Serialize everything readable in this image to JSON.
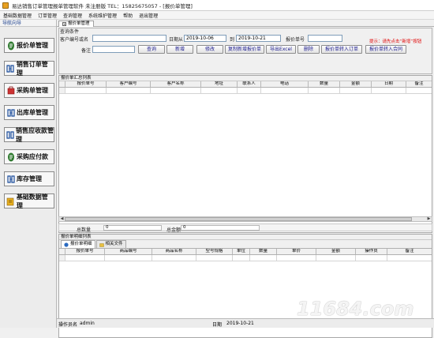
{
  "window": {
    "title": "易达销售订单管理报单管理软件 未注册版  TEL：15825675057    - [报价单管理]"
  },
  "menu": [
    "基础数据管理",
    "订单管理",
    "查询管理",
    "系统维护管理",
    "帮助",
    "退出管理"
  ],
  "nav": {
    "header": "导航向导",
    "items": [
      {
        "label": "报价单管理",
        "icon": "quote-icon"
      },
      {
        "label": "销售订单管理",
        "icon": "sales-order-icon"
      },
      {
        "label": "采购单管理",
        "icon": "purchase-icon"
      },
      {
        "label": "出库单管理",
        "icon": "outbound-icon"
      },
      {
        "label": "销售应收款管理",
        "icon": "receivable-icon"
      },
      {
        "label": "采购应付款",
        "icon": "payable-icon"
      },
      {
        "label": "库存管理",
        "icon": "inventory-icon"
      },
      {
        "label": "基础数据管理",
        "icon": "basic-data-icon"
      }
    ]
  },
  "tab": {
    "label": "报价单管理"
  },
  "query": {
    "group_label": "查询条件",
    "customer_label": "客户编号或名",
    "customer_value": "",
    "date_label": "日期从",
    "date_from": "2019-10-06",
    "date_to_label": "到",
    "date_to": "2019-10-21",
    "quote_no_label": "报价单号",
    "quote_no_value": "",
    "remark_label": "备注",
    "remark_value": "",
    "hint": "提示：请先点击“新增”按钮",
    "buttons": {
      "query": "查询",
      "add": "新增",
      "edit": "修改",
      "copy": "复制新增报价单",
      "export": "导出Excel",
      "delete": "删除",
      "to_order": "报价单转入订单",
      "to_contract": "报价单转入合同"
    }
  },
  "summary": {
    "caption": "报价单汇总列表",
    "columns": [
      "报价单号",
      "客户编号",
      "客户名称",
      "地址",
      "联系人",
      "电话",
      "数量",
      "金额",
      "日期",
      "备注"
    ],
    "total_qty_label": "总数量",
    "total_qty": "0",
    "total_amount_label": "总金额",
    "total_amount": "0"
  },
  "detail": {
    "caption": "报价单明细列表",
    "tabs": [
      "报价单明细",
      "相关文件"
    ],
    "columns": [
      "报价单号",
      "商品编号",
      "商品名称",
      "型号规格",
      "单位",
      "数量",
      "单价",
      "金额",
      "操作员",
      "备注"
    ]
  },
  "status": {
    "operator_label": "操作员名",
    "operator": "admin",
    "date_label": "日期",
    "date": "2019-10-21"
  },
  "watermark": "11684.com"
}
